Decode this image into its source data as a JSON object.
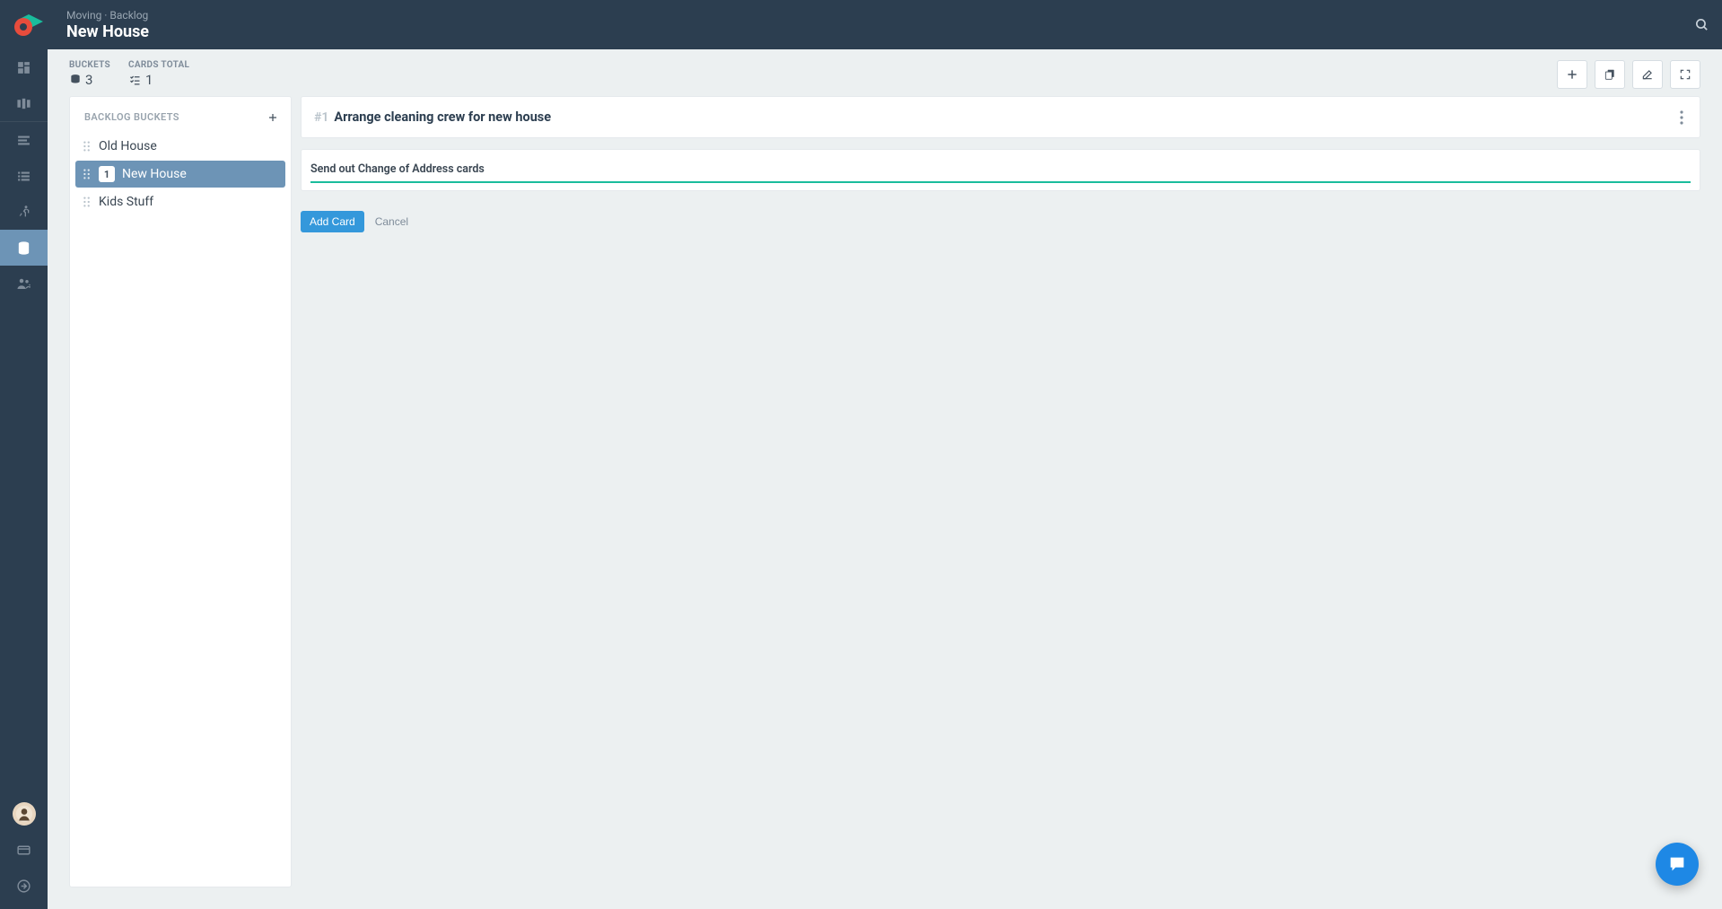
{
  "header": {
    "breadcrumb": "Moving · Backlog",
    "title": "New House"
  },
  "stats": {
    "buckets_label": "BUCKETS",
    "buckets_value": "3",
    "cards_label": "CARDS TOTAL",
    "cards_value": "1"
  },
  "buckets": {
    "header": "BACKLOG BUCKETS",
    "items": [
      {
        "label": "Old House",
        "count": "",
        "active": false
      },
      {
        "label": "New House",
        "count": "1",
        "active": true
      },
      {
        "label": "Kids Stuff",
        "count": "",
        "active": false
      }
    ]
  },
  "cards": [
    {
      "index": "#1",
      "title": "Arrange cleaning crew for new house"
    }
  ],
  "new_card": {
    "value": "Send out Change of Address cards",
    "add_label": "Add Card",
    "cancel_label": "Cancel"
  }
}
